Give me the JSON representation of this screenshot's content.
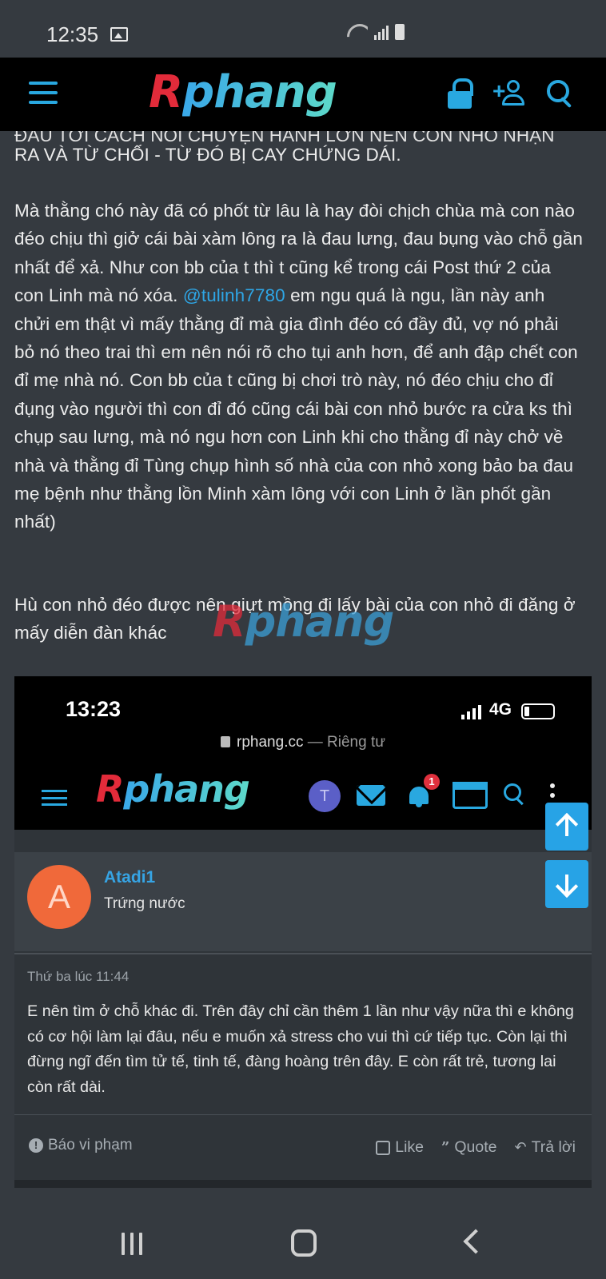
{
  "status_bar": {
    "time": "12:35"
  },
  "navbar": {
    "logo_r": "R",
    "logo_rest": "phang"
  },
  "post": {
    "cut_line": "ĐẦU TỚI CÁCH NÓI CHUYỆN HÀNH LỚN NÊN CON NHỎ NHẬN",
    "paragraph1": "RA VÀ TỪ CHỐI - TỪ ĐÓ BỊ CAY CHỨNG DÁI.",
    "paragraph2_before": "Mà thằng chó này đã có phốt từ lâu là hay đòi chịch chùa mà con nào đéo chịu thì giở cái bài xàm lông ra là đau lưng, đau bụng vào chỗ gần nhất để xả. Như con bb của t thì t cũng kể trong cái Post thứ 2 của con Linh mà nó xóa.",
    "mention": "@tulinh7780",
    "paragraph2_after": "em ngu quá là ngu, lần này anh chửi em thật vì mấy thằng đỉ mà gia đình đéo có đầy đủ, vợ nó phải bỏ nó theo trai thì em nên nói rõ cho tụi anh hơn, để anh đập chết con đỉ mẹ nhà nó. Con bb của t cũng bị chơi trò này, nó đéo chịu cho đỉ đụng vào người thì con đỉ đó cũng cái bài con nhỏ bước ra cửa ks thì chụp sau lưng, mà nó ngu hơn con Linh khi cho thằng đỉ này chở về nhà và thằng đỉ Tùng chụp hình số nhà của con nhỏ xong bảo ba đau mẹ bệnh như thằng lồn Minh xàm lông với con Linh ở lần phốt gần nhất)",
    "paragraph3": "Hù con nhỏ đéo được nên giựt mồng đi lấy bài của con nhỏ đi đăng ở mấy diễn đàn khác"
  },
  "watermark": {
    "r": "R",
    "rest": "phang"
  },
  "embedded_screenshot": {
    "time": "13:23",
    "network": "4G",
    "url": "rphang.cc",
    "url_suffix": "— Riêng tư",
    "logo_r": "R",
    "logo_rest": "phang",
    "avatar_letter": "T",
    "notification_count": "1",
    "user": {
      "avatar_letter": "A",
      "name": "Atadi1",
      "title": "Trứng nước"
    },
    "date": "Thứ ba lúc 11:44",
    "message": "E nên tìm ở chỗ khác đi. Trên đây chỉ cần thêm 1 lần như vậy nữa thì e không có cơ hội làm lại đâu, nếu e muốn xả stress cho vui thì cứ tiếp tục. Còn lại thì đừng ngĩ đến tìm tử tế, tinh tế, đàng hoàng trên đây. E còn rất trẻ, tương lai còn rất dài.",
    "report": "Báo vi phạm",
    "report_icon": "!",
    "like": "Like",
    "quote": "Quote",
    "quote_icon": "”",
    "reply": "Trả lời",
    "reply_icon": "↶"
  },
  "icons": [
    "menu-icon",
    "lock-icon",
    "add-user-icon",
    "search-icon",
    "arrow-up-icon",
    "arrow-down-icon"
  ],
  "colors": {
    "accent": "#29a8e0",
    "logo_red": "#e22b3a",
    "background": "#353a40",
    "scroll_button": "#27a3e6"
  }
}
